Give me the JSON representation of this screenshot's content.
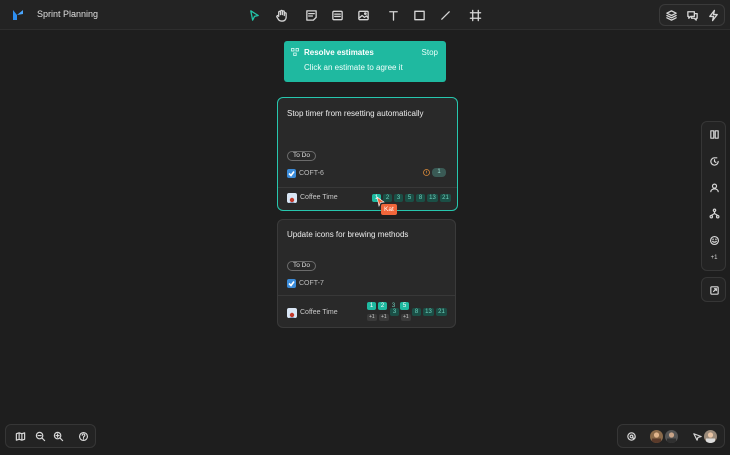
{
  "header": {
    "title": "Sprint Planning"
  },
  "banner": {
    "title": "Resolve estimates",
    "stop_label": "Stop",
    "subtitle": "Click an estimate to agree it"
  },
  "cards": [
    {
      "title": "Stop timer from resetting automatically",
      "status": "To Do",
      "issue_key": "COFT-6",
      "story_points": "1",
      "assignee": "Coffee Time",
      "estimates": [
        "1",
        "2",
        "3",
        "5",
        "8",
        "13",
        "21"
      ],
      "selected_estimate": "1"
    },
    {
      "title": "Update icons for brewing methods",
      "status": "To Do",
      "issue_key": "COFT-7",
      "assignee": "Coffee Time",
      "estimates": [
        "1",
        "2",
        "3",
        "5",
        "8",
        "13",
        "21"
      ],
      "voted_estimates": [
        "1",
        "2",
        "5"
      ],
      "vote_counts": [
        "+1",
        "+1",
        "+1"
      ]
    }
  ],
  "cursor": {
    "user": "Kat",
    "color": "#f0663a"
  },
  "side_toolbar": {
    "more_label": "+1"
  },
  "colors": {
    "accent": "#1fb9a0",
    "background": "#1e1e1e",
    "card": "#292929"
  }
}
